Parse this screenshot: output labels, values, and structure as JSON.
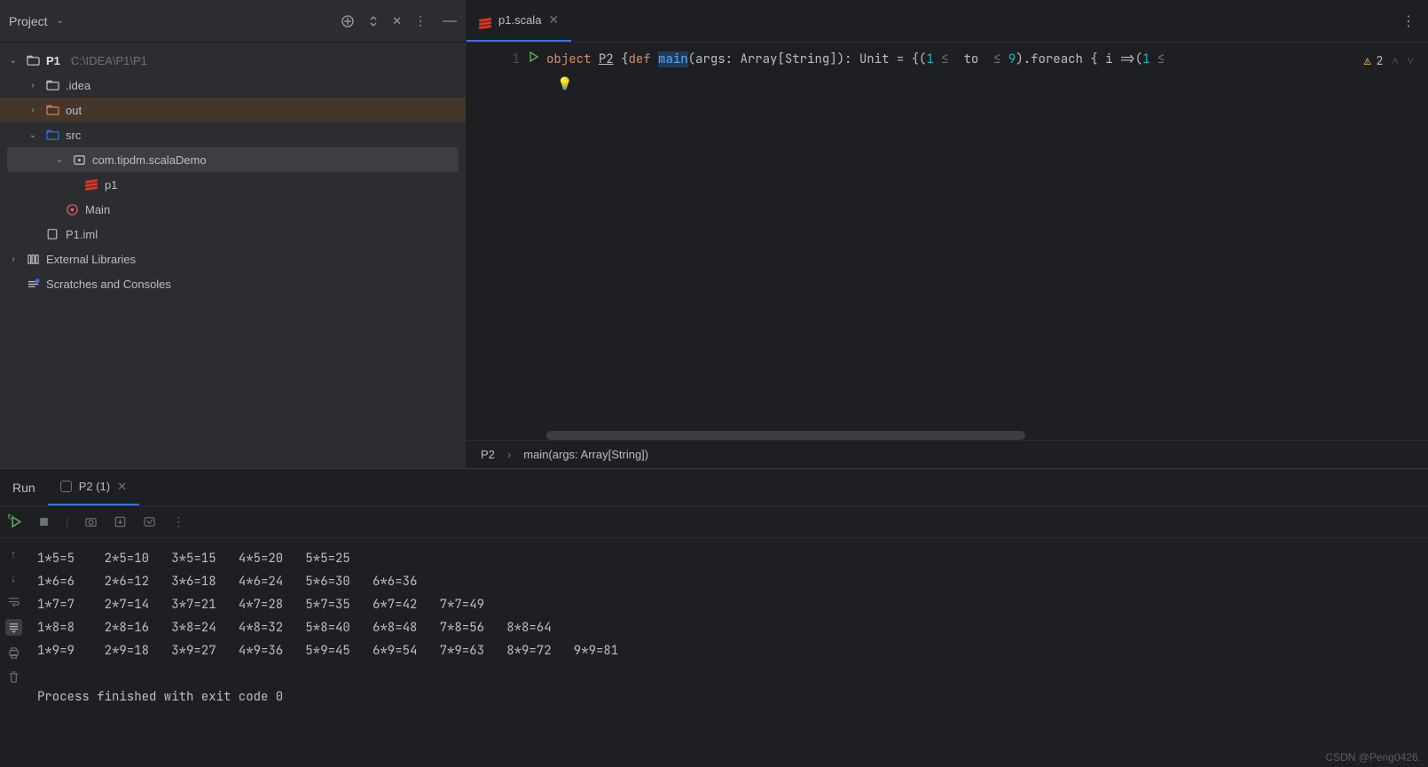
{
  "project_panel": {
    "title": "Project",
    "root": {
      "name": "P1",
      "path": "C:\\IDEA\\P1\\P1"
    },
    "items": {
      "idea": ".idea",
      "out": "out",
      "src": "src",
      "pkg": "com.tipdm.scalaDemo",
      "p1": "p1",
      "main": "Main",
      "iml": "P1.iml",
      "ext": "External Libraries",
      "scratch": "Scratches and Consoles"
    }
  },
  "editor": {
    "tab_name": "p1.scala",
    "line_number": "1",
    "code_tokens": {
      "object": "object",
      "p2": "P2",
      "brace_open": " {",
      "def": "def",
      "main": "main",
      "params": "(args: Array[String]): Unit = {(",
      "one_a": "1",
      "lte_a": " ≤ ",
      "to": " to ",
      "lte_b": " ≤ ",
      "nine": "9",
      "foreach": ").foreach { i =>(",
      "one_b": "1",
      "lte_c": " ≤"
    },
    "warning_count": "2",
    "breadcrumb": {
      "p2": "P2",
      "main": "main(args: Array[String])"
    }
  },
  "run": {
    "header_label": "Run",
    "tab_label": "P2 (1)",
    "output_lines": [
      "1*5=5    2*5=10   3*5=15   4*5=20   5*5=25",
      "1*6=6    2*6=12   3*6=18   4*6=24   5*6=30   6*6=36",
      "1*7=7    2*7=14   3*7=21   4*7=28   5*7=35   6*7=42   7*7=49",
      "1*8=8    2*8=16   3*8=24   4*8=32   5*8=40   6*8=48   7*8=56   8*8=64",
      "1*9=9    2*9=18   3*9=27   4*9=36   5*9=45   6*9=54   7*9=63   8*9=72   9*9=81",
      "",
      "Process finished with exit code 0"
    ]
  },
  "watermark": "CSDN @Peng0426."
}
